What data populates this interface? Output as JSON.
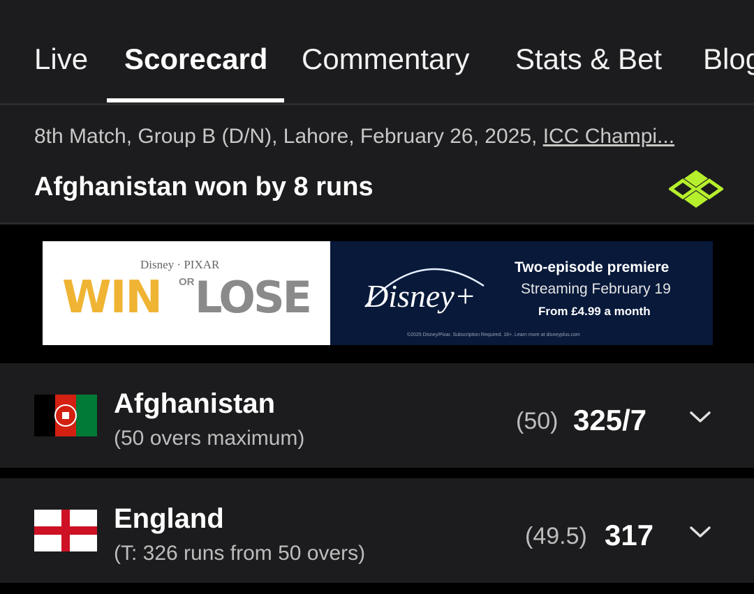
{
  "tabs": [
    {
      "label": "Live",
      "active": false
    },
    {
      "label": "Scorecard",
      "active": true
    },
    {
      "label": "Commentary",
      "active": false
    },
    {
      "label": "Stats & Bet",
      "active": false
    },
    {
      "label": "Blog",
      "active": false
    }
  ],
  "match": {
    "description": "8th Match, Group B (D/N), Lahore, February 26, 2025, ",
    "series_link": "ICC Champi...",
    "result": "Afghanistan won by 8 runs",
    "brand_icon": "layers-diamond-icon",
    "brand_color": "#b6f02c"
  },
  "ad": {
    "brand_line": "Disney · PIXAR",
    "title_win": "WIN",
    "title_or": "OR",
    "title_lose": "LOSE",
    "logo": "Disney+",
    "headline": "Two-episode premiere",
    "subline": "Streaming February 19",
    "price": "From £4.99 a month",
    "fine_print": "©2025 Disney/Pixar. Subscription Required. 18+. Learn more at disneyplus.com"
  },
  "teams": [
    {
      "name": "Afghanistan",
      "subtitle": "(50 overs maximum)",
      "overs": "(50)",
      "score": "325/7",
      "flag": "afghanistan-flag",
      "expand_icon": "chevron-down-icon"
    },
    {
      "name": "England",
      "subtitle": "(T: 326 runs from 50 overs)",
      "overs": "(49.5)",
      "score": "317",
      "flag": "england-flag",
      "expand_icon": "chevron-down-icon"
    }
  ]
}
